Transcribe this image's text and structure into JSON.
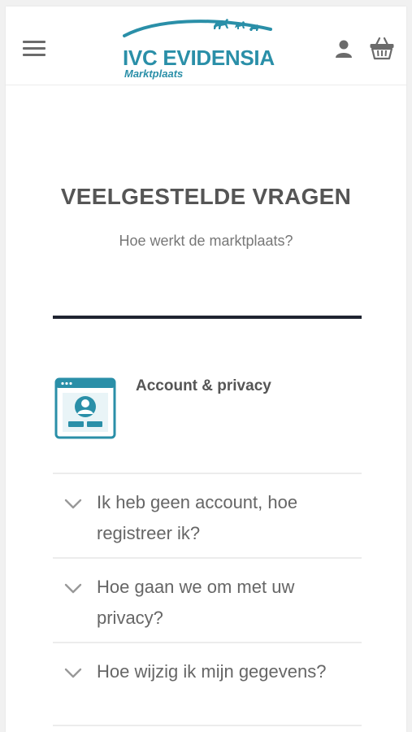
{
  "header": {
    "menu_icon": "hamburger-menu-icon",
    "logo": {
      "name": "IVC EVIDENSIA",
      "subtitle": "Marktplaats",
      "color": "#2a8fa8"
    },
    "account_icon": "user-icon",
    "cart_icon": "basket-icon"
  },
  "page": {
    "title": "VEELGESTELDE VRAGEN",
    "subtitle": "Hoe werkt de marktplaats?"
  },
  "category": {
    "icon": "account-window-icon",
    "title": "Account & privacy",
    "color": "#2a8fa8"
  },
  "faq": [
    {
      "icon": "chevron-down-icon",
      "question": "Ik heb geen account, hoe registreer ik?"
    },
    {
      "icon": "chevron-down-icon",
      "question": "Hoe gaan we om met uw privacy?"
    },
    {
      "icon": "chevron-down-icon",
      "question": "Hoe wijzig ik mijn gegevens?"
    }
  ]
}
